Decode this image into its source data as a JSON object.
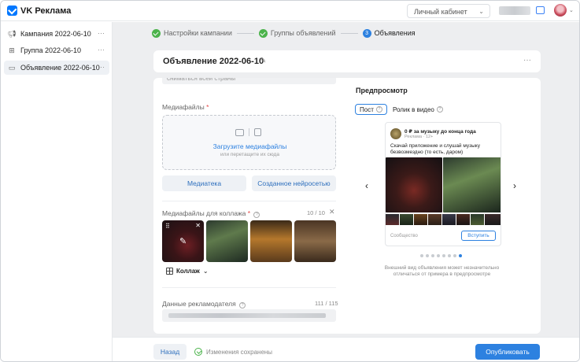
{
  "header": {
    "app_title": "VK Реклама",
    "cabinet_label": "Личный кабинет"
  },
  "sidebar": {
    "items": [
      {
        "label": "Кампания 2022-06-10"
      },
      {
        "label": "Группа 2022-06-10"
      },
      {
        "label": "Объявление 2022-06-10"
      }
    ]
  },
  "steps": [
    {
      "label": "Настройки кампании"
    },
    {
      "label": "Группы объявлений"
    },
    {
      "number": "3",
      "label": "Объявления"
    }
  ],
  "ad": {
    "title": "Объявление 2022-06-10"
  },
  "form": {
    "top_field_text": "сниматься всей страны",
    "media_label": "Медиафайлы",
    "required_mark": "*",
    "upload_link": "Загрузите медиафайлы",
    "upload_sub": "или перетащите их сюда",
    "library_button": "Медиатека",
    "ai_button": "Созданное нейросетью",
    "collage_media_label": "Медиафайлы для коллажа",
    "collage_counter": "10 / 10",
    "collage_button": "Коллаж",
    "advertiser_label": "Данные рекламодателя",
    "advertiser_counter": "111 / 115"
  },
  "preview": {
    "title": "Предпросмотр",
    "tab_post": "Пост",
    "tab_video": "Ролик в видео",
    "post_name": "0 ₽ за музыку до конца года",
    "post_sub": "Реклама · 12+",
    "post_text": "Скачай приложение и слушай музыку безвозмездно (то есть, даром)",
    "post_footer": "Сообщество",
    "join_button": "Вступить",
    "carousel": {
      "count": 8,
      "active_index": 7
    },
    "note": "Внешний вид объявления может незначительно отличаться от примера в предпросмотре"
  },
  "footer": {
    "back_button": "Назад",
    "saved_text": "Изменения сохранены",
    "publish_button": "Опубликовать"
  },
  "colors": {
    "accent": "#2d81e0",
    "success": "#4bb34b",
    "page_bg": "#edeef0"
  }
}
